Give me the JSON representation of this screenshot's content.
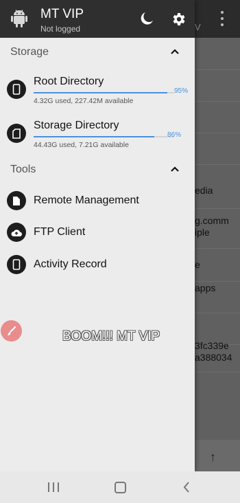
{
  "background": {
    "subtitle_fragment": "V",
    "rows": [
      "",
      "",
      "",
      "",
      "edia",
      "g.comm\niple",
      "e",
      "apps",
      "",
      "3fc339e\na388034"
    ]
  },
  "header": {
    "title": "MT VIP",
    "subtitle": "Not logged"
  },
  "storage": {
    "title": "Storage",
    "items": [
      {
        "name": "Root Directory",
        "percent_label": "95%",
        "percent": 0.95,
        "detail": "4.32G used, 227.42M available"
      },
      {
        "name": "Storage Directory",
        "percent_label": "86%",
        "percent": 0.86,
        "detail": "44.43G used, 7.21G available"
      }
    ]
  },
  "tools": {
    "title": "Tools",
    "items": [
      {
        "label": "Remote Management",
        "icon": "file-icon"
      },
      {
        "label": "FTP Client",
        "icon": "cloud-upload-icon"
      },
      {
        "label": "Activity Record",
        "icon": "phone-icon"
      }
    ]
  },
  "overlay_text": "BOOM!!! MT VIP",
  "colors": {
    "accent": "#4a90d9",
    "header_bg": "#2f2f2f",
    "drawer_bg": "#ececec",
    "fab": "#e98c8c"
  }
}
